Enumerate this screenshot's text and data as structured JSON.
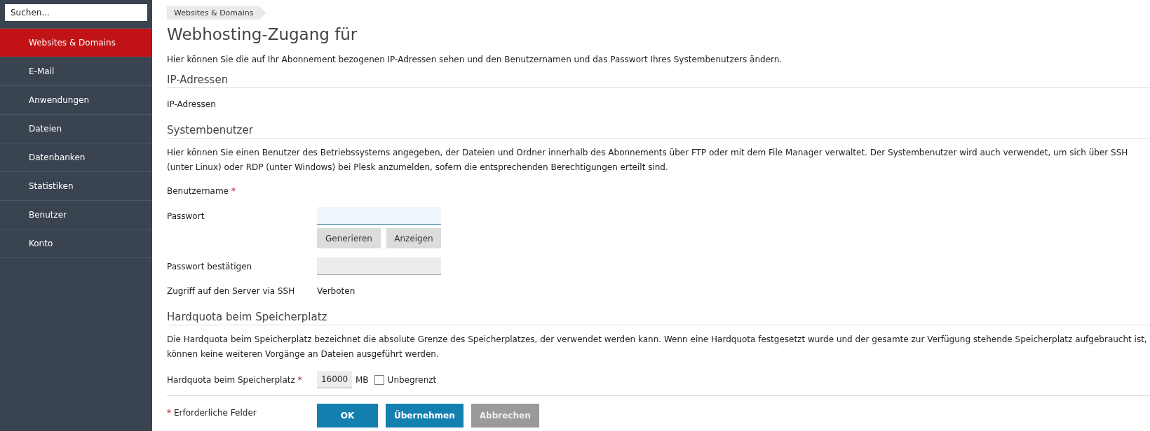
{
  "sidebar": {
    "search": {
      "placeholder": "Suchen..."
    },
    "items": [
      {
        "label": "Websites & Domains",
        "selected": true
      },
      {
        "label": "E-Mail",
        "selected": false
      },
      {
        "label": "Anwendungen",
        "selected": false
      },
      {
        "label": "Dateien",
        "selected": false
      },
      {
        "label": "Datenbanken",
        "selected": false
      },
      {
        "label": "Statistiken",
        "selected": false
      },
      {
        "label": "Benutzer",
        "selected": false
      },
      {
        "label": "Konto",
        "selected": false
      }
    ]
  },
  "breadcrumb": "Websites & Domains",
  "title": "Webhosting-Zugang für",
  "intro": "Hier können Sie die auf Ihr Abonnement bezogenen IP-Adressen sehen und den Benutzernamen und das Passwort Ihres Systembenutzers ändern.",
  "sections": [
    {
      "heading": "IP-Adressen",
      "rows": [
        {
          "kind": "text",
          "label": "IP-Adressen",
          "required": false
        }
      ]
    },
    {
      "heading": "Systembenutzer",
      "lines": [
        "Hier können Sie einen Benutzer des Betriebssystems angegeben, der Dateien und Ordner innerhalb des Abonnements über FTP oder mit dem File Manager verwaltet. Der Systembenutzer wird auch verwendet, um sich über SSH",
        "(unter Linux) oder RDP (unter Windows) bei Plesk anzumelden, sofern die entsprechenden Berechtigungen erteilt sind."
      ],
      "rows": [
        {
          "kind": "text",
          "label": "Benutzername",
          "required": true
        },
        {
          "kind": "password",
          "label": "Passwort",
          "required": false,
          "focused": true,
          "buttons": [
            "Generieren",
            "Anzeigen"
          ]
        },
        {
          "kind": "password",
          "label": "Passwort bestätigen",
          "required": false,
          "focused": false
        },
        {
          "kind": "text",
          "label": "Zugriff auf den Server via SSH",
          "required": false,
          "value": "Verboten"
        }
      ]
    },
    {
      "heading": "Hardquota beim Speicherplatz",
      "lines": [
        "Die Hardquota beim Speicherplatz bezeichnet die absolute Grenze des Speicherplatzes, der verwendet werden kann. Wenn eine Hardquota festgesetzt wurde und der gesamte zur Verfügung stehende Speicherplatz aufgebraucht ist,",
        "können keine weiteren Vorgänge an Dateien ausgeführt werden."
      ],
      "rows": [
        {
          "kind": "quota",
          "label": "Hardquota beim Speicherplatz",
          "required": true,
          "value": "16000",
          "unit": "MB",
          "checkbox": {
            "label": "Unbegrenzt",
            "checked": false
          }
        }
      ]
    }
  ],
  "footer": {
    "required_mark": "*",
    "required_note": "Erforderliche Felder"
  },
  "buttons": [
    {
      "label": "OK",
      "kind": "primary"
    },
    {
      "label": "Übernehmen",
      "kind": "primary"
    },
    {
      "label": "Abbrechen",
      "kind": "cancel"
    }
  ]
}
